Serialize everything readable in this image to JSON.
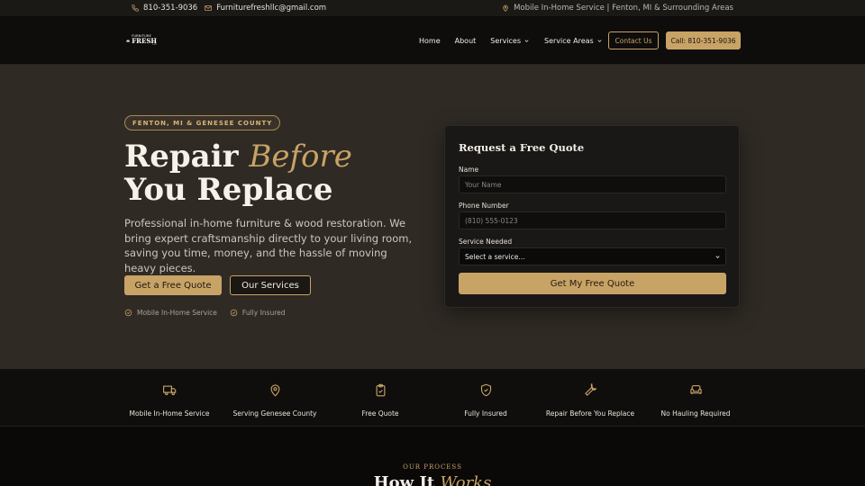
{
  "topbar": {
    "phone": "810-351-9036",
    "email": "Furniturefreshllc@gmail.com",
    "service_area": "Mobile In-Home Service | Fenton, MI & Surrounding Areas"
  },
  "nav": {
    "logo": {
      "line1": "FURNITURE",
      "line2": "FRESH",
      "line3": "LLC"
    },
    "items": [
      {
        "label": "Home"
      },
      {
        "label": "About"
      },
      {
        "label": "Services"
      },
      {
        "label": "Service Areas"
      }
    ],
    "contact_label": "Contact Us",
    "call_label": "Call: 810-351-9036"
  },
  "hero": {
    "badge": "FENTON, MI & GENESEE COUNTY",
    "title_a": "Repair ",
    "title_accent": "Before",
    "title_b": "You Replace",
    "lead": "Professional in-home furniture & wood restoration. We bring expert craftsmanship directly to your living room, saving you time, money, and the hassle of moving heavy pieces.",
    "cta_primary": "Get a Free Quote",
    "cta_secondary": "Our Services",
    "checks": [
      "Mobile In-Home Service",
      "Fully Insured"
    ]
  },
  "quote_form": {
    "title": "Request a Free Quote",
    "name_label": "Name",
    "name_placeholder": "Your Name",
    "phone_label": "Phone Number",
    "phone_placeholder": "(810) 555-0123",
    "service_label": "Service Needed",
    "service_selected": "Select a service...",
    "submit": "Get My Free Quote"
  },
  "features": [
    {
      "label": "Mobile In-Home Service",
      "icon": "truck-icon"
    },
    {
      "label": "Serving Genesee County",
      "icon": "map-pin-icon"
    },
    {
      "label": "Free Quote",
      "icon": "clipboard-check-icon"
    },
    {
      "label": "Fully Insured",
      "icon": "shield-check-icon"
    },
    {
      "label": "Repair Before You Replace",
      "icon": "wrench-icon"
    },
    {
      "label": "No Hauling Required",
      "icon": "sofa-icon"
    }
  ],
  "process": {
    "eyebrow": "OUR PROCESS",
    "title_a": "How It ",
    "title_accent": "Works"
  },
  "colors": {
    "accent": "#c8a366",
    "background": "#2f2a24",
    "dark": "#0e0d0c"
  }
}
